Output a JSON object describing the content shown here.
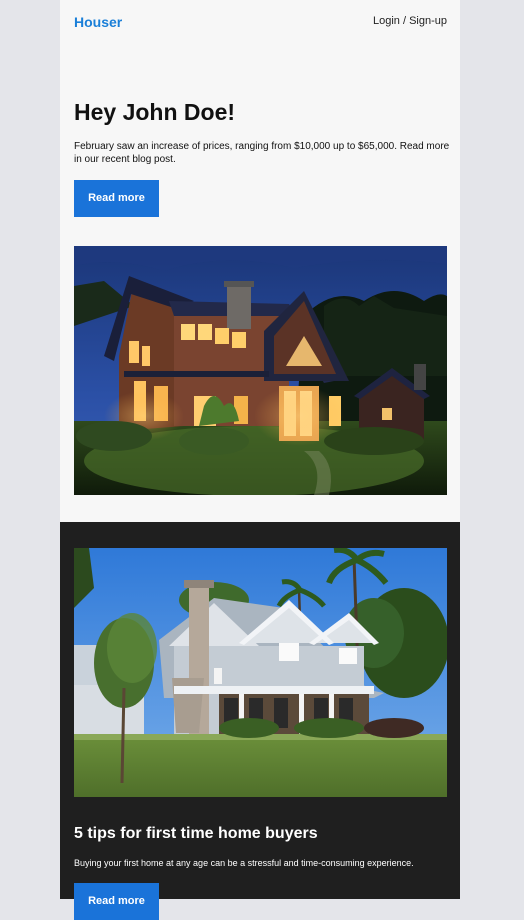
{
  "header": {
    "brand": "Houser",
    "login_label": "Login / Sign-up"
  },
  "hero": {
    "greeting": "Hey John Doe!",
    "intro": "February saw an increase of prices, ranging from $10,000 up to $65,000. Read more in our recent blog post.",
    "button_label": "Read more"
  },
  "article": {
    "title": "5 tips for first time home buyers",
    "description": "Buying your first home at any age can be a stressful and time-consuming experience.",
    "button_label": "Read more"
  },
  "colors": {
    "brand": "#1a7fd8",
    "button": "#1a73d9",
    "dark_section": "#1f1f1f"
  }
}
